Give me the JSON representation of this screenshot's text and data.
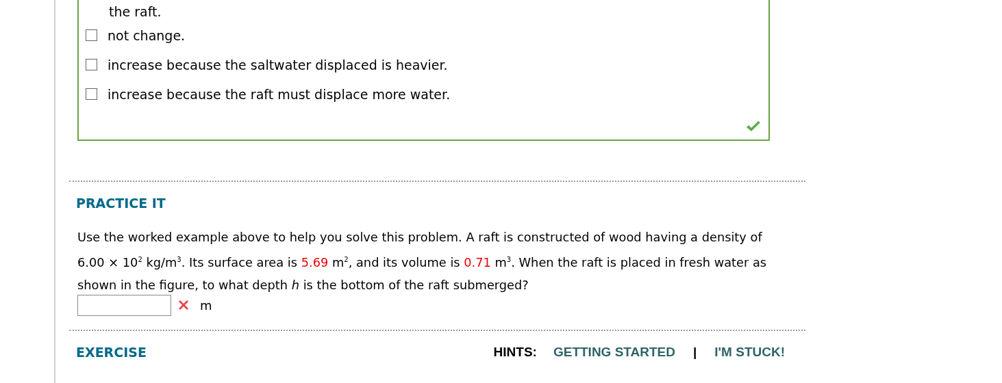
{
  "answer_box": {
    "options": [
      {
        "kind": "continuation",
        "label": "the raft."
      },
      {
        "kind": "checkbox",
        "label": "not change.",
        "checked": false
      },
      {
        "kind": "checkbox",
        "label": "increase because the saltwater displaced is heavier.",
        "checked": false
      },
      {
        "kind": "checkbox",
        "label": "increase because the raft must displace more water.",
        "checked": false
      }
    ],
    "correct": true
  },
  "practice": {
    "heading": "PRACTICE IT",
    "problem": [
      {
        "kind": "plain",
        "text": "Use the worked example above to help you solve this problem. A raft is constructed of wood having a density of 6.00 × 10$^{2}$ kg/m$^{3}$. Its surface area is "
      },
      {
        "kind": "value",
        "text": "5.69"
      },
      {
        "kind": "plain",
        "text": " m$^{2}$, and its volume is "
      },
      {
        "kind": "value",
        "text": "0.71"
      },
      {
        "kind": "plain",
        "text": " m$^{3}$. When the raft is placed in fresh water as shown in the figure, to what depth *h* is the bottom of the raft submerged?"
      }
    ],
    "answer": {
      "correct": false,
      "unit": "m"
    }
  },
  "exercise": {
    "heading": "EXERCISE",
    "hints_label": "HINTS:",
    "hints": [
      "GETTING STARTED",
      "I'M STUCK!"
    ],
    "separator": "|"
  }
}
